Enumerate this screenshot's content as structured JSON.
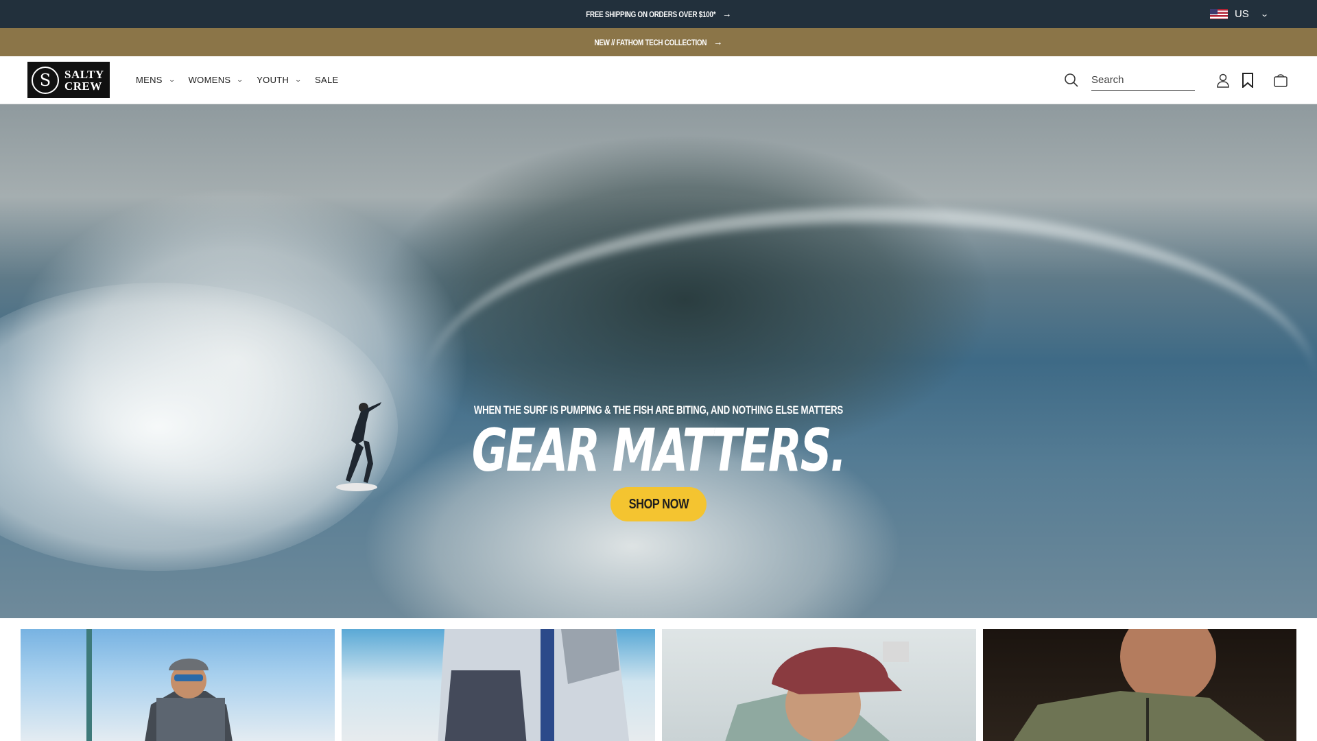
{
  "announcement": {
    "shipping_text": "FREE SHIPPING ON ORDERS OVER $100*",
    "collection_text": "NEW // FATHOM TECH COLLECTION"
  },
  "locale": {
    "country": "US"
  },
  "brand": {
    "logo_line1": "SALTY",
    "logo_line2": "CREW"
  },
  "nav": {
    "items": [
      {
        "label": "MENS",
        "dropdown": true
      },
      {
        "label": "WOMENS",
        "dropdown": true
      },
      {
        "label": "YOUTH",
        "dropdown": true
      },
      {
        "label": "SALE",
        "dropdown": false
      }
    ]
  },
  "search": {
    "placeholder": "Search"
  },
  "hero": {
    "subtitle": "WHEN THE SURF IS PUMPING & THE FISH ARE BITING, AND NOTHING ELSE MATTERS",
    "title": "GEAR MATTERS.",
    "cta": "SHOP NOW"
  },
  "colors": {
    "topbar": "#22303c",
    "promobar": "#8b7548",
    "cta": "#f4c430"
  },
  "icons": [
    "arrow-right-icon",
    "us-flag-icon",
    "chevron-down-icon",
    "search-icon",
    "account-icon",
    "bookmark-icon",
    "cart-icon"
  ]
}
